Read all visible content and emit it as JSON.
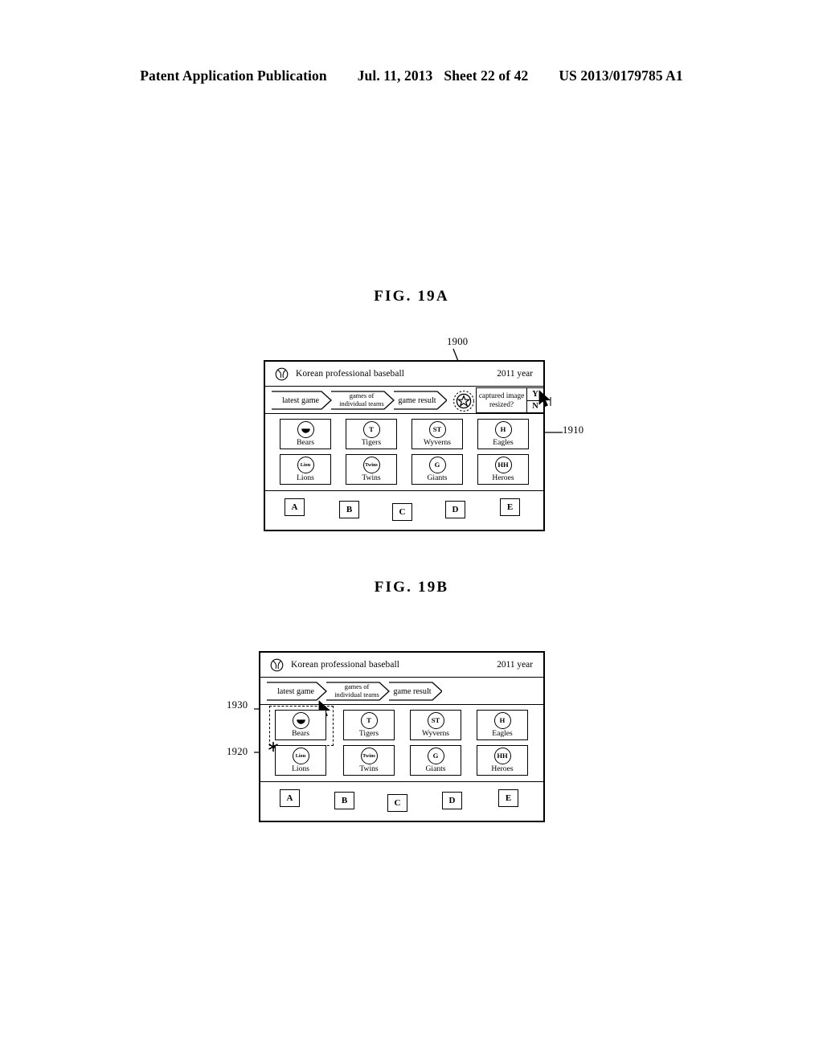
{
  "page_header": {
    "left": "Patent Application Publication",
    "date": "Jul. 11, 2013",
    "sheet": "Sheet 22 of 42",
    "pub_number": "US 2013/0179785 A1"
  },
  "figures": [
    {
      "caption": "FIG. 19A",
      "refs": [
        {
          "id": "ref-1900",
          "label": "1900"
        },
        {
          "id": "ref-1910",
          "label": "1910"
        }
      ],
      "screen": {
        "title_bar": {
          "icon": "baseball-icon",
          "title": "Korean professional baseball",
          "year": "2011 year"
        },
        "breadcrumbs": [
          {
            "label": "latest game",
            "lines": [
              "latest game"
            ]
          },
          {
            "label": "games of individual teams",
            "lines": [
              "games of",
              "individual teams"
            ]
          },
          {
            "label": "game result",
            "lines": [
              "game result"
            ]
          }
        ],
        "star_icon": "star-in-circle-icon",
        "tooltip": {
          "line1": "captured image",
          "line2": "resized?",
          "yes": "Y",
          "no": "N"
        },
        "cursor": "mouse-cursor-icon",
        "teams": [
          {
            "name": "Bears",
            "logo": "smile",
            "logo_text": ""
          },
          {
            "name": "Tigers",
            "logo": "text",
            "logo_text": "T"
          },
          {
            "name": "Wyverns",
            "logo": "text",
            "logo_text": "ST"
          },
          {
            "name": "Eagles",
            "logo": "text",
            "logo_text": "H"
          },
          {
            "name": "Lions",
            "logo": "tiny",
            "logo_text": "Lion"
          },
          {
            "name": "Twins",
            "logo": "tiny",
            "logo_text": "Twins"
          },
          {
            "name": "Giants",
            "logo": "text",
            "logo_text": "G"
          },
          {
            "name": "Heroes",
            "logo": "text",
            "logo_text": "HH"
          }
        ],
        "letters": [
          "A",
          "B",
          "C",
          "D",
          "E"
        ]
      }
    },
    {
      "caption": "FIG. 19B",
      "refs": [
        {
          "id": "ref-1930",
          "label": "1930"
        },
        {
          "id": "ref-1920",
          "label": "1920"
        }
      ],
      "screen": {
        "title_bar": {
          "icon": "baseball-icon",
          "title": "Korean professional baseball",
          "year": "2011 year"
        },
        "breadcrumbs": [
          {
            "label": "latest game",
            "lines": [
              "latest game"
            ]
          },
          {
            "label": "games of individual teams",
            "lines": [
              "games of",
              "individual teams"
            ]
          },
          {
            "label": "game result",
            "lines": [
              "game result"
            ]
          }
        ],
        "selection": {
          "target": "Bears",
          "marker": "asterisk-marker"
        },
        "cursor": "mouse-cursor-icon",
        "teams": [
          {
            "name": "Bears",
            "logo": "smile",
            "logo_text": ""
          },
          {
            "name": "Tigers",
            "logo": "text",
            "logo_text": "T"
          },
          {
            "name": "Wyverns",
            "logo": "text",
            "logo_text": "ST"
          },
          {
            "name": "Eagles",
            "logo": "text",
            "logo_text": "H"
          },
          {
            "name": "Lions",
            "logo": "tiny",
            "logo_text": "Lion"
          },
          {
            "name": "Twins",
            "logo": "tiny",
            "logo_text": "Twins"
          },
          {
            "name": "Giants",
            "logo": "text",
            "logo_text": "G"
          },
          {
            "name": "Heroes",
            "logo": "text",
            "logo_text": "HH"
          }
        ],
        "letters": [
          "A",
          "B",
          "C",
          "D",
          "E"
        ]
      }
    }
  ],
  "colors": {
    "ink": "#000000",
    "paper": "#ffffff"
  }
}
